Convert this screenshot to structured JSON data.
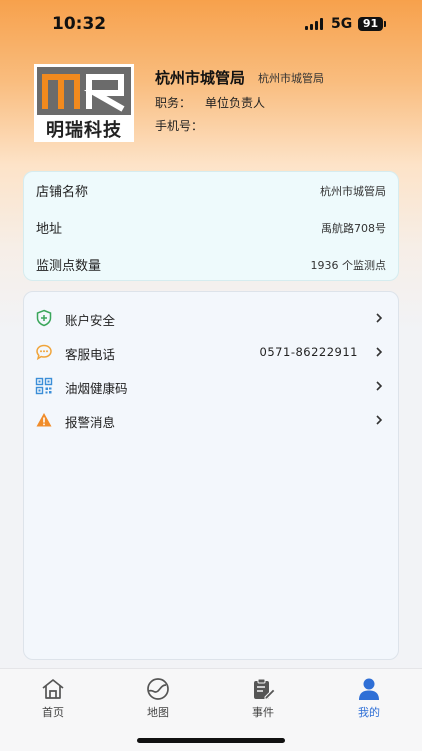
{
  "status_bar": {
    "time": "10:32",
    "network": "5G",
    "battery": "91"
  },
  "profile": {
    "logo_text": "明瑞科技",
    "org_name": "杭州市城管局",
    "org_sub": "杭州市城管局",
    "role_label": "职务：",
    "role_value": "单位负责人",
    "phone_label": "手机号：",
    "phone_value": ""
  },
  "info": [
    {
      "label": "店铺名称",
      "value": "杭州市城管局"
    },
    {
      "label": "地址",
      "value": "禹航路708号"
    },
    {
      "label": "监测点数量",
      "value": "1936 个监测点"
    }
  ],
  "menu": [
    {
      "label": "账户安全",
      "icon": "shield-plus-icon",
      "extra": ""
    },
    {
      "label": "客服电话",
      "icon": "chat-bubble-icon",
      "extra": "0571-86222911"
    },
    {
      "label": "油烟健康码",
      "icon": "qr-code-icon",
      "extra": ""
    },
    {
      "label": "报警消息",
      "icon": "warning-icon",
      "extra": ""
    }
  ],
  "tabs": [
    {
      "label": "首页",
      "icon": "home-icon",
      "active": false
    },
    {
      "label": "地图",
      "icon": "map-icon",
      "active": false
    },
    {
      "label": "事件",
      "icon": "clipboard-edit-icon",
      "active": false
    },
    {
      "label": "我的",
      "icon": "user-icon",
      "active": true
    }
  ],
  "colors": {
    "accent": "#2f6fd6",
    "header_orange": "#f7a14c",
    "logo_orange": "#f28a1e",
    "logo_gray": "#6b6b6b"
  }
}
